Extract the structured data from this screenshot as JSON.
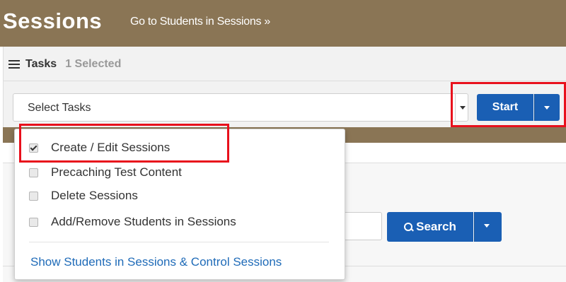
{
  "header": {
    "title": "Sessions",
    "goto_link": "Go to Students in Sessions »"
  },
  "tasks": {
    "label": "Tasks",
    "selected_count": "1 Selected",
    "select_value": "Select Tasks",
    "start_label": "Start"
  },
  "menu": {
    "items": [
      {
        "label": "Create / Edit Sessions",
        "checked": true
      },
      {
        "label": "Precaching Test Content",
        "checked": false
      },
      {
        "label": "Delete Sessions",
        "checked": false
      },
      {
        "label": "Add/Remove Students in Sessions",
        "checked": false
      }
    ],
    "link": "Show Students in Sessions & Control Sessions"
  },
  "search": {
    "label": "Search",
    "value": ""
  },
  "colors": {
    "header_bg": "#8a7555",
    "primary_button": "#1a5fb4",
    "highlight_box": "#e8101c",
    "link": "#1f6bb8"
  },
  "icons": {
    "tasks": "list-icon",
    "search": "magnifier-icon",
    "dropdown": "caret-down-icon",
    "check": "checkbox-icon"
  }
}
